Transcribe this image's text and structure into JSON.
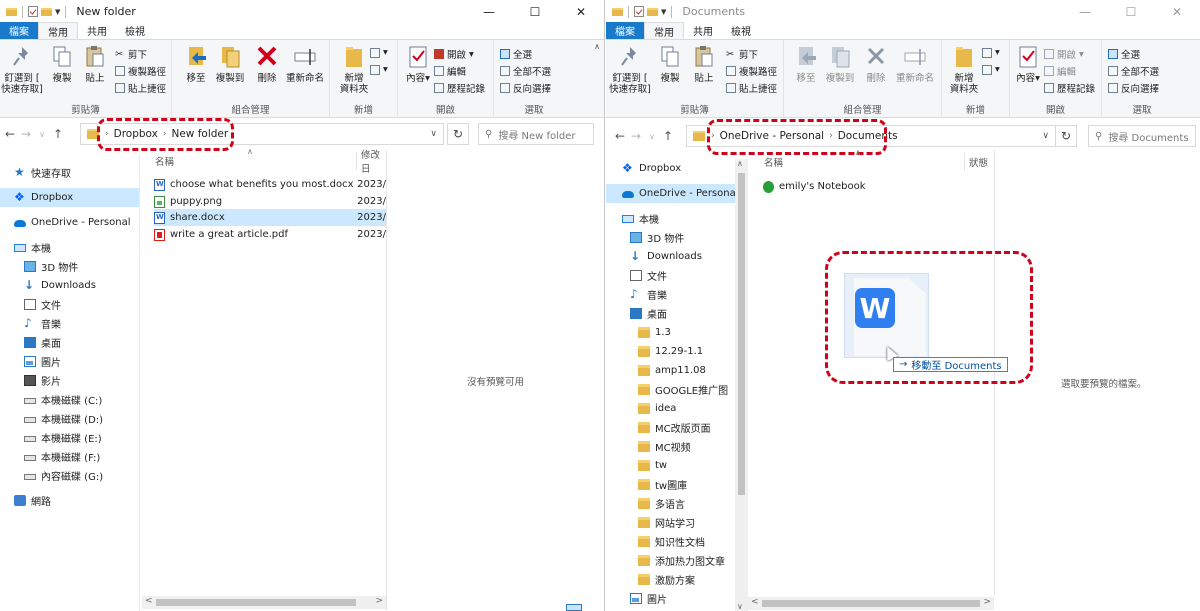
{
  "left": {
    "title": "New folder",
    "tabs": {
      "file": "檔案",
      "home": "常用",
      "share": "共用",
      "view": "檢視"
    },
    "ribbon": {
      "pin": "釘選到 [\n快速存取]",
      "copy": "複製",
      "paste": "貼上",
      "cut": "剪下",
      "copy_path": "複製路徑",
      "paste_shortcut": "貼上捷徑",
      "clipboard": "剪貼簿",
      "move_to": "移至",
      "copy_to": "複製到",
      "delete": "刪除",
      "rename": "重新命名",
      "organize": "組合管理",
      "new_folder": "新增\n資料夾",
      "new": "新增",
      "properties": "內容",
      "open": "開啟",
      "edit": "編輯",
      "history": "歷程記錄",
      "open_group": "開啟",
      "select_all": "全選",
      "select_none": "全部不選",
      "invert": "反向選擇",
      "select": "選取"
    },
    "address": {
      "root": "Dropbox",
      "folder": "New folder"
    },
    "search_placeholder": "搜尋 New folder",
    "nav": {
      "quick": "快速存取",
      "dropbox": "Dropbox",
      "onedrive": "OneDrive - Personal",
      "pc": "本機",
      "items": [
        "3D 物件",
        "Downloads",
        "文件",
        "音樂",
        "桌面",
        "圖片",
        "影片",
        "本機磁碟 (C:)",
        "本機磁碟 (D:)",
        "本機磁碟 (E:)",
        "本機磁碟 (F:)",
        "內容磁碟 (G:)"
      ],
      "network": "網路"
    },
    "headers": {
      "name": "名稱",
      "date": "修改日"
    },
    "files": [
      {
        "name": "choose what benefits you most.docx",
        "date": "2023/"
      },
      {
        "name": "puppy.png",
        "date": "2023/"
      },
      {
        "name": "share.docx",
        "date": "2023/"
      },
      {
        "name": "write a great article.pdf",
        "date": "2023/"
      }
    ],
    "preview_msg": "沒有預覽可用"
  },
  "right": {
    "title": "Documents",
    "tabs": {
      "file": "檔案",
      "home": "常用",
      "share": "共用",
      "view": "檢視"
    },
    "ribbon": {
      "pin": "釘選到 [\n快速存取]",
      "copy": "複製",
      "paste": "貼上",
      "cut": "剪下",
      "copy_path": "複製路徑",
      "paste_shortcut": "貼上捷徑",
      "clipboard": "剪貼簿",
      "move_to": "移至",
      "copy_to": "複製到",
      "delete": "刪除",
      "rename": "重新命名",
      "organize": "組合管理",
      "new_folder": "新增\n資料夾",
      "new": "新增",
      "properties": "內容",
      "open": "開啟",
      "edit": "編輯",
      "history": "歷程記錄",
      "open_group": "開啟",
      "select_all": "全選",
      "select_none": "全部不選",
      "invert": "反向選擇",
      "select": "選取"
    },
    "address": {
      "root": "OneDrive - Personal",
      "folder": "Documents"
    },
    "search_placeholder": "搜尋 Documents",
    "nav": {
      "dropbox": "Dropbox",
      "onedrive": "OneDrive - Personal",
      "pc": "本機",
      "items": [
        "3D 物件",
        "Downloads",
        "文件",
        "音樂",
        "桌面"
      ],
      "folders": [
        "1.3",
        "12.29-1.1",
        "amp11.08",
        "GOOGLE推广图",
        "idea",
        "MC改版页面",
        "MC视频",
        "tw",
        "tw圖庫",
        "多语言",
        "网站学习",
        "知识性文档",
        "添加热力图文章",
        "激励方案"
      ],
      "last": "圖片"
    },
    "headers": {
      "name": "名稱",
      "status": "狀態"
    },
    "files": [
      {
        "name": "emily's Notebook"
      }
    ],
    "preview_msg": "選取要預覽的檔案。",
    "drag_tip": "移動至 Documents",
    "drag_icon": "W"
  }
}
